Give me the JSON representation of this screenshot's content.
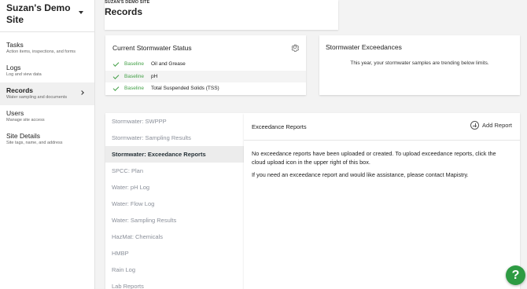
{
  "sidebar": {
    "site_name": "Suzan's Demo Site",
    "items": [
      {
        "label": "Tasks",
        "sub": "Action items, inspections, and forms"
      },
      {
        "label": "Logs",
        "sub": "Log and view data"
      },
      {
        "label": "Records",
        "sub": "Water sampling and documents"
      },
      {
        "label": "Users",
        "sub": "Manage site access"
      },
      {
        "label": "Site Details",
        "sub": "Site tags, name, and address"
      }
    ]
  },
  "header": {
    "eyebrow": "SUZAN'S DEMO SITE",
    "title": "Records"
  },
  "status_card": {
    "title": "Current Stormwater Status",
    "rows": [
      {
        "level": "Baseline",
        "parameter": "Oil and Grease"
      },
      {
        "level": "Baseline",
        "parameter": "pH"
      },
      {
        "level": "Baseline",
        "parameter": "Total Suspended Solids (TSS)"
      }
    ]
  },
  "exceed_card": {
    "title": "Stormwater Exceedances",
    "message": "This year, your stormwater samples are trending below limits."
  },
  "records_list": [
    "Stormwater: SWPPP",
    "Stormwater: Sampling Results",
    "Stormwater: Exceedance Reports",
    "SPCC: Plan",
    "Water: pH Log",
    "Water: Flow Log",
    "Water: Sampling Results",
    "HazMat: Chemicals",
    "HMBP",
    "Rain Log",
    "Lab Reports"
  ],
  "detail": {
    "title": "Exceedance Reports",
    "add_label": "Add Report",
    "p1": "No exceedance reports have been uploaded or created. To upload exceedance reports, click the cloud upload icon in the upper right of this box.",
    "p2": "If you need an exceedance report and would like assistance, please contact Mapistry."
  },
  "help": "?",
  "colors": {
    "accent_green": "#43a047",
    "help_green": "#2e9b43"
  }
}
